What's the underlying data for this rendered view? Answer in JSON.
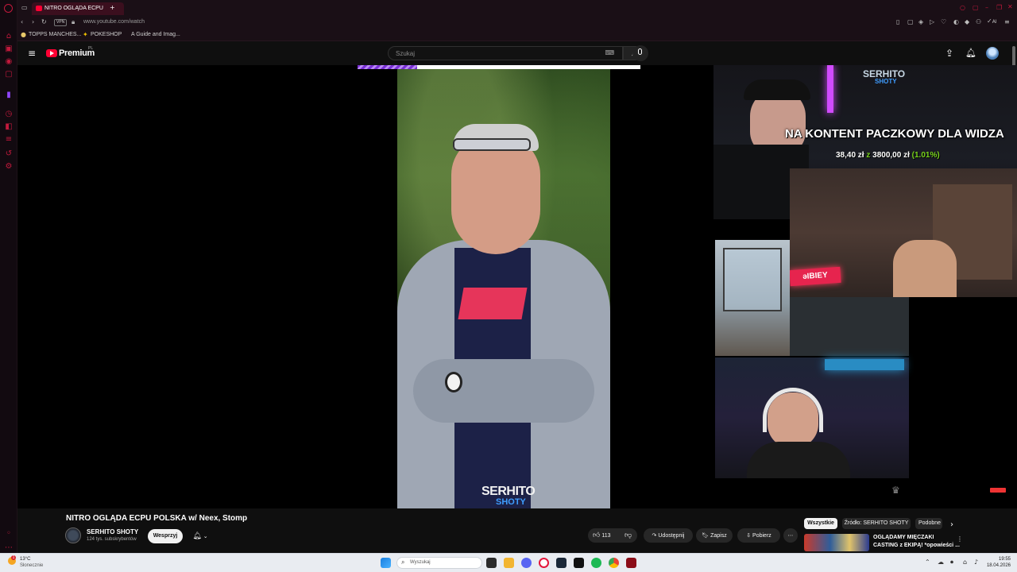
{
  "browser": {
    "tab_title": "NITRO OGLĄDA ECPU",
    "url": "www.youtube.com/watch",
    "vpn_label": "VPN",
    "new_tab_icon": "plus-icon",
    "bookmarks": [
      "TOPPS MANCHES...",
      "POKESHOP",
      "A Guide and Imag..."
    ],
    "ai_label": "AI",
    "accent": "#c2193c"
  },
  "youtube": {
    "logo_text": "Premium",
    "logo_badge": "PL",
    "search_placeholder": "Szukaj",
    "brand_color": "#ff0033"
  },
  "video": {
    "overlay_channel": "SERHITO",
    "overlay_channel_sub": "SHOTY",
    "bottom_watermark": "SERHITO",
    "bottom_watermark_sub": "SHOTY",
    "banner_text": "NA KONTENT PACZKOWY DLA WIDZA",
    "goal_current": "38,40 zł",
    "goal_sep": "z",
    "goal_target": "3800,00 zł",
    "goal_percent": "(1.01%)",
    "neon_sign": "ǝIBIEY",
    "title_progress": 0.21
  },
  "meta": {
    "title": "NITRO OGLĄDA ECPU POLSKA w/ Neex, Stomp",
    "channel_name": "SERHITO SHOTY",
    "subscribers": "124 tys. subskrybentów",
    "support_label": "Wesprzyj",
    "like_count": "113",
    "share_label": "Udostępnij",
    "save_label": "Zapisz",
    "download_label": "Pobierz"
  },
  "chips": [
    "Wszystkie",
    "Źródło: SERHITO SHOTY",
    "Podobne"
  ],
  "recommended": {
    "title_line1": "OGLĄDAMY MIĘCZAKI",
    "title_line2": "CASTING z EKIPĄ! *opowieści ..."
  },
  "taskbar": {
    "weather_temp": "13°C",
    "weather_desc": "Słonecznie",
    "search_placeholder": "Wyszukaj",
    "time": "19:55",
    "date": "18.04.2026"
  }
}
